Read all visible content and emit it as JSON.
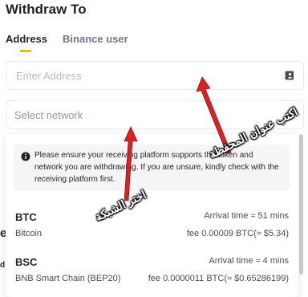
{
  "header": {
    "title": "Withdraw To"
  },
  "tabs": [
    {
      "label": "Address",
      "active": true
    },
    {
      "label": "Binance user",
      "active": false
    }
  ],
  "address_field": {
    "placeholder": "Enter Address",
    "icon": "address-book-icon"
  },
  "network_select": {
    "placeholder": "Select network",
    "icon": "chevron-up-icon"
  },
  "notice": {
    "icon": "info-icon",
    "text": "Please ensure your receiving platform supports the token and network you are withdrawing. If you are unsure, kindly check with the receiving platform first."
  },
  "networks": [
    {
      "symbol": "BTC",
      "name": "Bitcoin",
      "arrival": "Arrival time ≈ 51 mins",
      "fee": "fee 0.00009 BTC(≈ $5.34)"
    },
    {
      "symbol": "BSC",
      "name": "BNB Smart Chain (BEP20)",
      "arrival": "Arrival time ≈ 4 mins",
      "fee": "fee 0.0000011 BTC(≈ $0.65286199)"
    }
  ],
  "annotations": {
    "address": "اكتب عنوان المحفظة",
    "network": "اختر الشبكة",
    "color": "#e02020"
  },
  "background_fragments": {
    "partial_1": "e",
    "partial_2": "d"
  }
}
